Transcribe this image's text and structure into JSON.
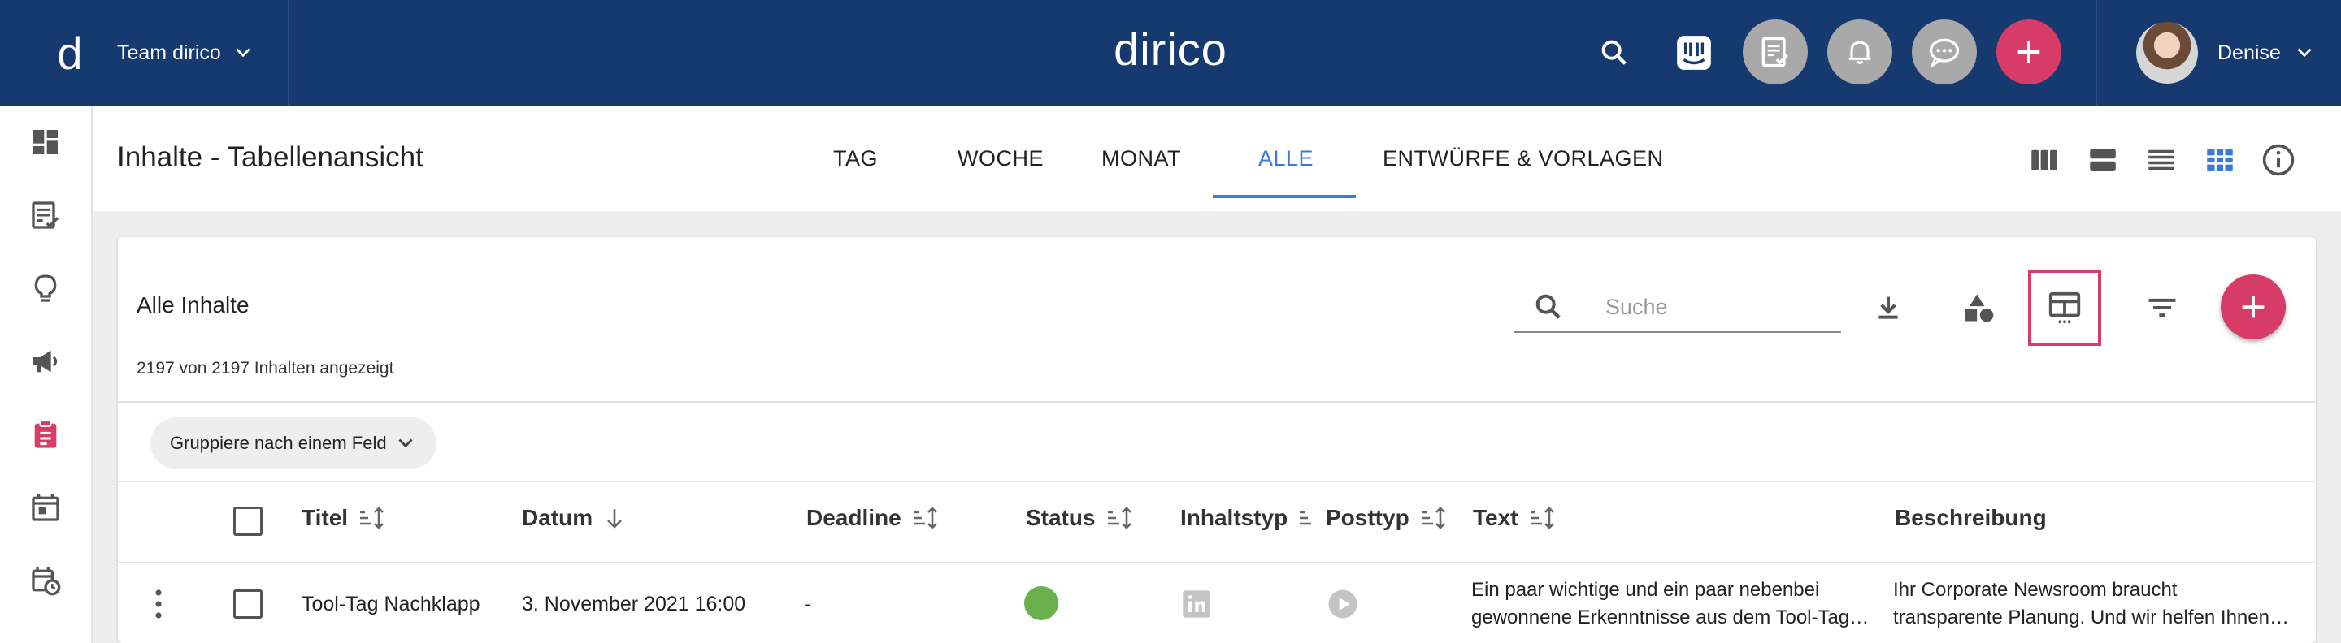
{
  "topbar": {
    "logo_letter": "d",
    "team_name": "Team dirico",
    "brand": "dirico",
    "user_name": "Denise",
    "colors": {
      "bar": "#163a70",
      "accent": "#d63c67"
    },
    "icons": [
      "search-icon",
      "intercom-icon",
      "content-check-icon",
      "bell-icon",
      "chat-icon",
      "add-icon"
    ]
  },
  "sidebar": {
    "items": [
      "dashboard-icon",
      "content-list-icon",
      "idea-icon",
      "campaign-icon",
      "clipboard-icon",
      "calendar-icon",
      "schedule-icon"
    ]
  },
  "header": {
    "title": "Inhalte - Tabellenansicht",
    "tabs": [
      {
        "label": "TAG",
        "active": false
      },
      {
        "label": "WOCHE",
        "active": false
      },
      {
        "label": "MONAT",
        "active": false
      },
      {
        "label": "ALLE",
        "active": true
      },
      {
        "label": "ENTWÜRFE & VORLAGEN",
        "active": false
      }
    ],
    "view_icons": [
      "columns-view-icon",
      "rows-view-icon",
      "list-view-icon",
      "table-view-icon",
      "info-icon"
    ]
  },
  "card": {
    "title": "Alle Inhalte",
    "count": "2197 von 2197 Inhalten angezeigt",
    "search_placeholder": "Suche",
    "group_by": "Gruppiere nach einem Feld"
  },
  "table": {
    "columns": [
      "Titel",
      "Datum",
      "Deadline",
      "Status",
      "Inhaltstyp",
      "Posttyp",
      "Text",
      "Beschreibung"
    ],
    "rows": [
      {
        "title": "Tool-Tag Nachklapp",
        "date": "3. November 2021 16:00",
        "deadline": "-",
        "status_color": "#6ab04c",
        "content_type_icon": "linkedin-icon",
        "post_type_icon": "video-icon",
        "text_line1": "Ein paar wichtige und ein paar nebenbei",
        "text_line2": "gewonnene Erkenntnisse aus dem Tool-Tag…",
        "desc_line1": "Ihr Corporate Newsroom braucht",
        "desc_line2": "transparente Planung. Und wir helfen Ihnen…"
      }
    ]
  }
}
